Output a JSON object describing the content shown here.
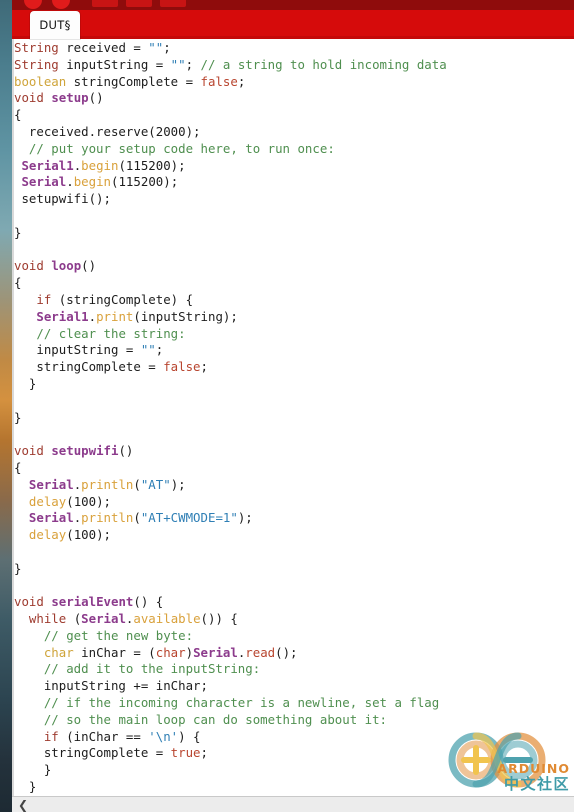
{
  "app": {
    "name": "Arduino IDE",
    "toolbar": {
      "buttons": [
        {
          "name": "verify-button",
          "shape": "round"
        },
        {
          "name": "upload-button",
          "shape": "round"
        },
        {
          "name": "new-button",
          "shape": "square"
        },
        {
          "name": "open-button",
          "shape": "square"
        },
        {
          "name": "save-button",
          "shape": "square"
        }
      ],
      "bg_color": "#8f0c0c"
    },
    "tab_strip": {
      "bg_color": "#d60b0b",
      "tabs": [
        {
          "label": "DUT§",
          "active": true
        }
      ]
    }
  },
  "editor": {
    "background": "#ffffff",
    "font_size_px": 12.4,
    "colors": {
      "keyword": "#9e3b2f",
      "type": "#cfa43a",
      "function": "#8c3b8c",
      "method": "#d9a13b",
      "comment": "#4f8f4f",
      "string": "#2f7fb5",
      "literal": "#b8452f",
      "plain": "#1d1d1d"
    },
    "lines": [
      [
        {
          "t": "String",
          "c": "kw"
        },
        {
          "t": " received = ",
          "c": "pl"
        },
        {
          "t": "\"\"",
          "c": "str"
        },
        {
          "t": ";",
          "c": "pl"
        }
      ],
      [
        {
          "t": "String",
          "c": "kw"
        },
        {
          "t": " inputString = ",
          "c": "pl"
        },
        {
          "t": "\"\"",
          "c": "str"
        },
        {
          "t": "; ",
          "c": "pl"
        },
        {
          "t": "// a string to hold incoming data",
          "c": "cmt"
        }
      ],
      [
        {
          "t": "boolean",
          "c": "kw2"
        },
        {
          "t": " stringComplete = ",
          "c": "pl"
        },
        {
          "t": "false",
          "c": "lit"
        },
        {
          "t": ";",
          "c": "pl"
        }
      ],
      [
        {
          "t": "void",
          "c": "kw"
        },
        {
          "t": " ",
          "c": "pl"
        },
        {
          "t": "setup",
          "c": "fn"
        },
        {
          "t": "()",
          "c": "pl"
        }
      ],
      [
        {
          "t": "{",
          "c": "pl"
        }
      ],
      [
        {
          "t": "  received.reserve(2000);",
          "c": "pl"
        }
      ],
      [
        {
          "t": "  ",
          "c": "pl"
        },
        {
          "t": "// put your setup code here, to run once:",
          "c": "cmt"
        }
      ],
      [
        {
          "t": " ",
          "c": "pl"
        },
        {
          "t": "Serial1",
          "c": "fn"
        },
        {
          "t": ".",
          "c": "pl"
        },
        {
          "t": "begin",
          "c": "fn2"
        },
        {
          "t": "(115200);",
          "c": "pl"
        }
      ],
      [
        {
          "t": " ",
          "c": "pl"
        },
        {
          "t": "Serial",
          "c": "fn"
        },
        {
          "t": ".",
          "c": "pl"
        },
        {
          "t": "begin",
          "c": "fn2"
        },
        {
          "t": "(115200);",
          "c": "pl"
        }
      ],
      [
        {
          "t": " setupwifi();",
          "c": "pl"
        }
      ],
      [
        {
          "t": "",
          "c": "pl"
        }
      ],
      [
        {
          "t": "}",
          "c": "pl"
        }
      ],
      [
        {
          "t": "",
          "c": "pl"
        }
      ],
      [
        {
          "t": "void",
          "c": "kw"
        },
        {
          "t": " ",
          "c": "pl"
        },
        {
          "t": "loop",
          "c": "fn"
        },
        {
          "t": "()",
          "c": "pl"
        }
      ],
      [
        {
          "t": "{",
          "c": "pl"
        }
      ],
      [
        {
          "t": "   ",
          "c": "pl"
        },
        {
          "t": "if",
          "c": "kw"
        },
        {
          "t": " (stringComplete) {",
          "c": "pl"
        }
      ],
      [
        {
          "t": "   ",
          "c": "pl"
        },
        {
          "t": "Serial1",
          "c": "fn"
        },
        {
          "t": ".",
          "c": "pl"
        },
        {
          "t": "print",
          "c": "fn2"
        },
        {
          "t": "(inputString);",
          "c": "pl"
        }
      ],
      [
        {
          "t": "   ",
          "c": "pl"
        },
        {
          "t": "// clear the string:",
          "c": "cmt"
        }
      ],
      [
        {
          "t": "   inputString = ",
          "c": "pl"
        },
        {
          "t": "\"\"",
          "c": "str"
        },
        {
          "t": ";",
          "c": "pl"
        }
      ],
      [
        {
          "t": "   stringComplete = ",
          "c": "pl"
        },
        {
          "t": "false",
          "c": "lit"
        },
        {
          "t": ";",
          "c": "pl"
        }
      ],
      [
        {
          "t": "  }",
          "c": "pl"
        }
      ],
      [
        {
          "t": "",
          "c": "pl"
        }
      ],
      [
        {
          "t": "}",
          "c": "pl"
        }
      ],
      [
        {
          "t": "",
          "c": "pl"
        }
      ],
      [
        {
          "t": "void",
          "c": "kw"
        },
        {
          "t": " ",
          "c": "pl"
        },
        {
          "t": "setupwifi",
          "c": "fn"
        },
        {
          "t": "()",
          "c": "pl"
        }
      ],
      [
        {
          "t": "{",
          "c": "pl"
        }
      ],
      [
        {
          "t": "  ",
          "c": "pl"
        },
        {
          "t": "Serial",
          "c": "fn"
        },
        {
          "t": ".",
          "c": "pl"
        },
        {
          "t": "println",
          "c": "fn2"
        },
        {
          "t": "(",
          "c": "pl"
        },
        {
          "t": "\"AT\"",
          "c": "str"
        },
        {
          "t": ");",
          "c": "pl"
        }
      ],
      [
        {
          "t": "  ",
          "c": "pl"
        },
        {
          "t": "delay",
          "c": "fn2"
        },
        {
          "t": "(100);",
          "c": "pl"
        }
      ],
      [
        {
          "t": "  ",
          "c": "pl"
        },
        {
          "t": "Serial",
          "c": "fn"
        },
        {
          "t": ".",
          "c": "pl"
        },
        {
          "t": "println",
          "c": "fn2"
        },
        {
          "t": "(",
          "c": "pl"
        },
        {
          "t": "\"AT+CWMODE=1\"",
          "c": "str"
        },
        {
          "t": ");",
          "c": "pl"
        }
      ],
      [
        {
          "t": "  ",
          "c": "pl"
        },
        {
          "t": "delay",
          "c": "fn2"
        },
        {
          "t": "(100);",
          "c": "pl"
        }
      ],
      [
        {
          "t": "",
          "c": "pl"
        }
      ],
      [
        {
          "t": "}",
          "c": "pl"
        }
      ],
      [
        {
          "t": "",
          "c": "pl"
        }
      ],
      [
        {
          "t": "void",
          "c": "kw"
        },
        {
          "t": " ",
          "c": "pl"
        },
        {
          "t": "serialEvent",
          "c": "fn"
        },
        {
          "t": "() {",
          "c": "pl"
        }
      ],
      [
        {
          "t": "  ",
          "c": "pl"
        },
        {
          "t": "while",
          "c": "kw"
        },
        {
          "t": " (",
          "c": "pl"
        },
        {
          "t": "Serial",
          "c": "fn"
        },
        {
          "t": ".",
          "c": "pl"
        },
        {
          "t": "available",
          "c": "fn2"
        },
        {
          "t": "()) {",
          "c": "pl"
        }
      ],
      [
        {
          "t": "    ",
          "c": "pl"
        },
        {
          "t": "// get the new byte:",
          "c": "cmt"
        }
      ],
      [
        {
          "t": "    ",
          "c": "pl"
        },
        {
          "t": "char",
          "c": "kw2"
        },
        {
          "t": " inChar = (",
          "c": "pl"
        },
        {
          "t": "char",
          "c": "lit"
        },
        {
          "t": ")",
          "c": "pl"
        },
        {
          "t": "Serial",
          "c": "fn"
        },
        {
          "t": ".",
          "c": "pl"
        },
        {
          "t": "read",
          "c": "lit"
        },
        {
          "t": "();",
          "c": "pl"
        }
      ],
      [
        {
          "t": "    ",
          "c": "pl"
        },
        {
          "t": "// add it to the inputString:",
          "c": "cmt"
        }
      ],
      [
        {
          "t": "    inputString += inChar;",
          "c": "pl"
        }
      ],
      [
        {
          "t": "    ",
          "c": "pl"
        },
        {
          "t": "// if the incoming character is a newline, set a flag",
          "c": "cmt"
        }
      ],
      [
        {
          "t": "    ",
          "c": "pl"
        },
        {
          "t": "// so the main loop can do something about it:",
          "c": "cmt"
        }
      ],
      [
        {
          "t": "    ",
          "c": "pl"
        },
        {
          "t": "if",
          "c": "kw"
        },
        {
          "t": " (inChar == ",
          "c": "pl"
        },
        {
          "t": "'\\n'",
          "c": "str"
        },
        {
          "t": ") {",
          "c": "pl"
        }
      ],
      [
        {
          "t": "    stringComplete = ",
          "c": "pl"
        },
        {
          "t": "true",
          "c": "lit"
        },
        {
          "t": ";",
          "c": "pl"
        }
      ],
      [
        {
          "t": "    }",
          "c": "pl"
        }
      ],
      [
        {
          "t": "  }",
          "c": "pl"
        }
      ]
    ]
  },
  "watermark": {
    "brand_en": "ARDUINO",
    "brand_cn": "中文社区",
    "teal": "#3f9ba8",
    "orange": "#e08a33"
  },
  "status_bar": {
    "chevron": "❮",
    "background": "#ececec"
  }
}
